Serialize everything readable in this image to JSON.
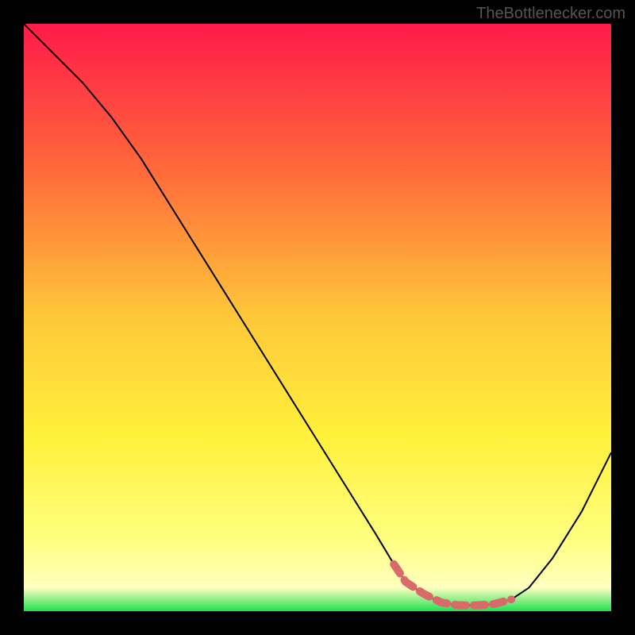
{
  "watermark": "TheBottlenecker.com",
  "chart_data": {
    "type": "line",
    "title": "",
    "xlabel": "",
    "ylabel": "",
    "xlim": [
      0,
      100
    ],
    "ylim": [
      0,
      100
    ],
    "gradient_stops": [
      {
        "offset": 0,
        "color": "#ff1a4a"
      },
      {
        "offset": 25,
        "color": "#ff6a3a"
      },
      {
        "offset": 50,
        "color": "#ffc83a"
      },
      {
        "offset": 70,
        "color": "#fff03a"
      },
      {
        "offset": 88,
        "color": "#ffff80"
      },
      {
        "offset": 96,
        "color": "#ffffc0"
      },
      {
        "offset": 100,
        "color": "#20e050"
      }
    ],
    "series": [
      {
        "name": "bottleneck-curve",
        "stroke": "#000000",
        "x": [
          0,
          5,
          10,
          15,
          20,
          25,
          30,
          35,
          40,
          45,
          50,
          55,
          60,
          63,
          65,
          68,
          71,
          74,
          77,
          80,
          83,
          86,
          90,
          95,
          100
        ],
        "values": [
          100,
          95,
          90,
          84,
          77,
          69,
          61,
          53,
          45,
          37,
          29,
          21,
          13,
          8,
          5,
          3,
          1.5,
          1,
          1,
          1.2,
          2,
          4,
          9,
          17,
          27
        ]
      },
      {
        "name": "optimal-band",
        "stroke": "#d96a6a",
        "stroke_width": 10,
        "x": [
          63,
          65,
          68,
          71,
          74,
          77,
          80,
          83
        ],
        "values": [
          8,
          5,
          3,
          1.5,
          1,
          1,
          1.2,
          2
        ]
      }
    ]
  }
}
